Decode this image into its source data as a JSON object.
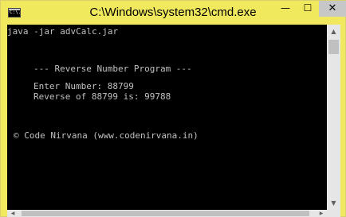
{
  "window": {
    "title": "C:\\Windows\\system32\\cmd.exe",
    "icon_label": "C:\\.",
    "min_icon": "—",
    "max_icon": "☐",
    "close_icon": "✕"
  },
  "console": {
    "lines": [
      "java -jar advCalc.jar",
      "--- Reverse Number Program ---",
      "Enter Number: 88799",
      "Reverse of 88799 is: 99788",
      "© Code Nirvana (www.codenirvana.in)"
    ]
  },
  "scrollbars": {
    "up_arrow": "▲",
    "down_arrow": "▼",
    "left_arrow": "◀",
    "right_arrow": "▶"
  },
  "colors": {
    "titlebar": "#f1e95d",
    "console_bg": "#000000",
    "console_text": "#c0c0c0"
  }
}
